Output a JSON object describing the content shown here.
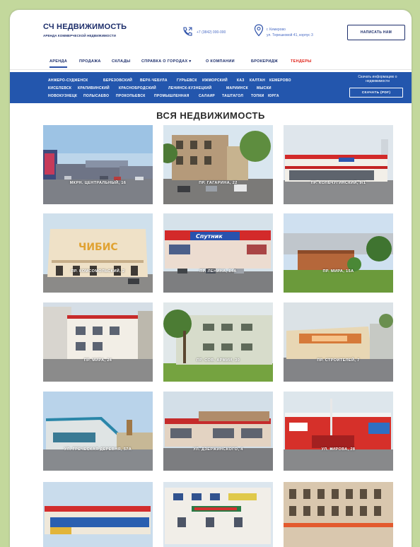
{
  "header": {
    "logo_title": "СЧ НЕДВИЖИМОСТЬ",
    "logo_subtitle": "АРЕНДА КОММЕРЧЕСКОЙ НЕДВИЖИМОСТИ",
    "phone": "+7 (3842) 000-000",
    "address_line1": "г. Кемерово",
    "address_line2": "ул. Терешковой 41, корпус 3",
    "write_button": "НАПИСАТЬ НАМ"
  },
  "nav": {
    "items": [
      {
        "label": "АРЕНДА"
      },
      {
        "label": "ПРОДАЖА"
      },
      {
        "label": "СКЛАДЫ"
      },
      {
        "label": "СПРАВКА О ГОРОДАХ ▾"
      },
      {
        "label": "О КОМПАНИИ"
      },
      {
        "label": "БРОКЕРИДЖ"
      },
      {
        "label": "ТЕНДЕРЫ"
      }
    ]
  },
  "cities": {
    "row1": [
      "АНЖЕРО-СУДЖЕНСК",
      "БЕРЕЗОВСКИЙ",
      "ВЕРХ-ЧЕБУЛА",
      "ГУРЬЕВСК",
      "ИЖМОРСКИЙ",
      "КАЗ",
      "КАЛТАН",
      "КЕМЕРОВО"
    ],
    "row2": [
      "КИСЕЛЕВСК",
      "КРАПИВИНСКИЙ",
      "КРАСНОБРОДСКИЙ",
      "ЛЕНИНСК-КУЗНЕЦКИЙ",
      "МАРИИНСК",
      "МЫСКИ"
    ],
    "row3": [
      "НОВОКУЗНЕЦК",
      "ПОЛЫСАЕВО",
      "ПРОКОПЬЕВСК",
      "ПРОМЫШЛЕННАЯ",
      "САЛАИР",
      "ТАШТАГОЛ",
      "ТОПКИ",
      "ЮРГА"
    ],
    "info_line1": "Скачать информацию о",
    "info_line2": "недвижимости",
    "download_button": "СКАЧАТЬ (PDF)"
  },
  "section_title": "ВСЯ НЕДВИЖИМОСТЬ",
  "properties": [
    {
      "label": "МКРН. ЦЕНТРАЛЬНЫЙ, 16"
    },
    {
      "label": "ПР. ГАГАРИНА, 22"
    },
    {
      "label": "ПР. КОЛЬЧУГИНСКИЙ, 9/1"
    },
    {
      "label": "ПР. КОМСОМОЛЬСКИЙ, 2"
    },
    {
      "label": "ПР. ЛЕНИНА, 84А"
    },
    {
      "label": "ПР. МИРА, 15А"
    },
    {
      "label": "ПР. МИРА, 24"
    },
    {
      "label": "ПР. СОВ. АРМИИ, 30"
    },
    {
      "label": "ПР. СТРОИТЕЛЕЙ, 7"
    },
    {
      "label": "УЛ. ГРЕЧЕСКАЯ ДЕРЕВНЯ, 57А"
    },
    {
      "label": "УЛ. ДЗЕРЖИНСКОГО, 4"
    },
    {
      "label": "УЛ. КИРОВА, 28"
    },
    {
      "label": ""
    },
    {
      "label": ""
    },
    {
      "label": ""
    }
  ],
  "signs": {
    "chibis": "ЧИБИС",
    "sputnik": "Спутник"
  },
  "colors": {
    "brand_blue": "#1d2e6b",
    "band_blue": "#2356ad",
    "tender_red": "#e0251b",
    "page_bg": "#c3d89c"
  }
}
